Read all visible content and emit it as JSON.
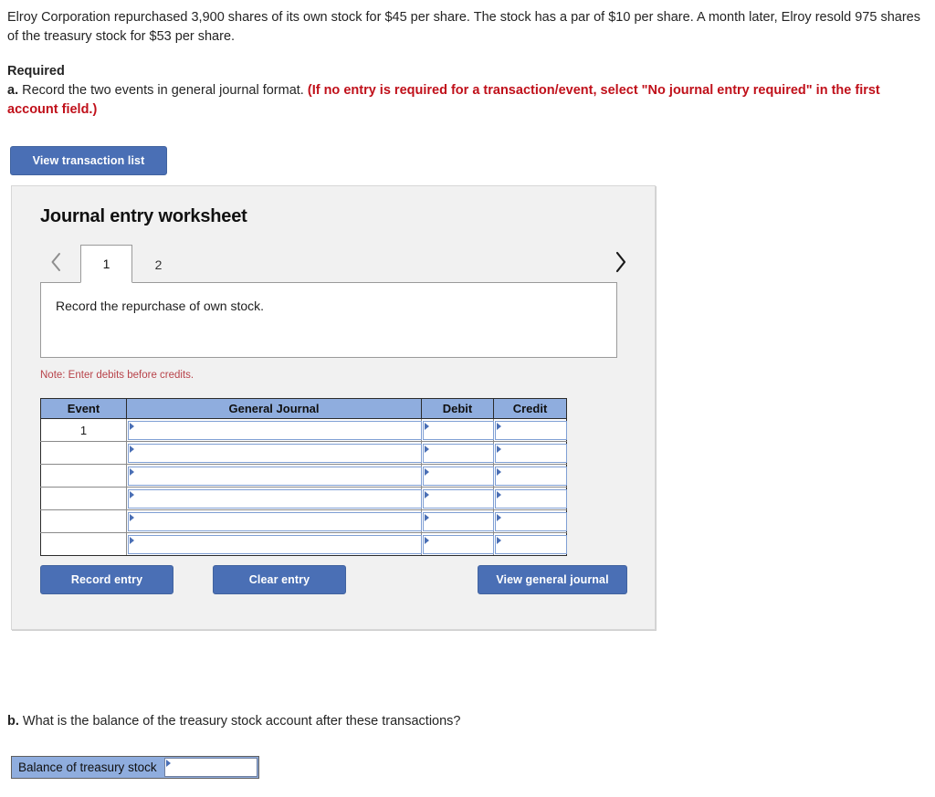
{
  "problem": {
    "statement": "Elroy Corporation repurchased 3,900 shares of its own stock for $45 per share. The stock has a par of $10 per share. A month later, Elroy resold 975 shares of the treasury stock for $53 per share."
  },
  "required": {
    "heading": "Required",
    "item_a_label": "a.",
    "item_a_text": "Record the two events in general journal format.",
    "item_a_hint": "(If no entry is required for a transaction/event, select \"No journal entry required\" in the first account field.)"
  },
  "toolbar": {
    "view_transaction_list_label": "View transaction list"
  },
  "worksheet": {
    "title": "Journal entry worksheet",
    "prev_icon": "chevron-left-icon",
    "next_icon": "chevron-right-icon",
    "tabs": [
      {
        "label": "1",
        "active": true
      },
      {
        "label": "2",
        "active": false
      }
    ],
    "description": "Record the repurchase of own stock.",
    "note": "Note: Enter debits before credits.",
    "table": {
      "columns": [
        "Event",
        "General Journal",
        "Debit",
        "Credit"
      ],
      "rows": [
        {
          "event": "1",
          "general_journal": "",
          "debit": "",
          "credit": ""
        },
        {
          "event": "",
          "general_journal": "",
          "debit": "",
          "credit": ""
        },
        {
          "event": "",
          "general_journal": "",
          "debit": "",
          "credit": ""
        },
        {
          "event": "",
          "general_journal": "",
          "debit": "",
          "credit": ""
        },
        {
          "event": "",
          "general_journal": "",
          "debit": "",
          "credit": ""
        },
        {
          "event": "",
          "general_journal": "",
          "debit": "",
          "credit": ""
        }
      ]
    },
    "buttons": {
      "record_entry": "Record entry",
      "clear_entry": "Clear entry",
      "view_general_journal": "View general journal"
    }
  },
  "part_b": {
    "label": "b.",
    "question": "What is the balance of the treasury stock account after these transactions?",
    "field_label": "Balance of treasury stock",
    "field_value": ""
  },
  "colors": {
    "button_blue": "#4a6fb5",
    "table_header_blue": "#8fadde",
    "alert_red": "#c0101a",
    "note_red": "#b8434a",
    "panel_bg": "#f1f1f1"
  }
}
